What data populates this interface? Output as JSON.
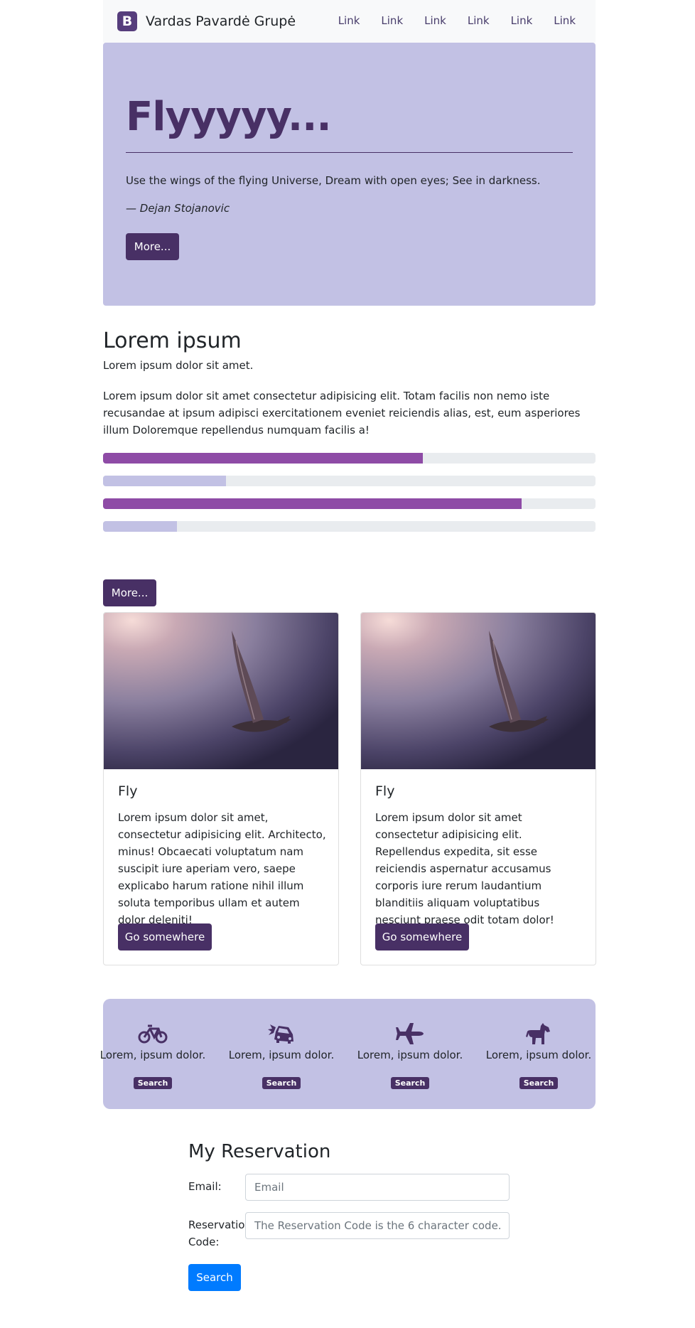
{
  "navbar": {
    "brand_logo": "B",
    "brand_name": "Vardas Pavardė Grupė",
    "links": [
      "Link",
      "Link",
      "Link",
      "Link",
      "Link",
      "Link"
    ]
  },
  "jumbotron": {
    "title": "Flyyyyy...",
    "quote": "Use the wings of the flying Universe, Dream with open eyes; See in darkness.",
    "author": "— Dejan Stojanovic",
    "button": "More..."
  },
  "lorem": {
    "heading": "Lorem ipsum",
    "short": "Lorem ipsum dolor sit amet.",
    "long": "Lorem ipsum dolor sit amet consectetur adipisicing elit. Totam facilis non nemo iste recusandae at ipsum adipisci exercitationem eveniet reiciendis alias, est, eum asperiores illum Doloremque repellendus numquam facilis a!",
    "progress": [
      {
        "value": 65,
        "color": "#8e4ba6"
      },
      {
        "value": 25,
        "color": "#c2c1e4"
      },
      {
        "value": 85,
        "color": "#8e4ba6"
      },
      {
        "value": 15,
        "color": "#c2c1e4"
      }
    ],
    "more_button": "More..."
  },
  "cards": [
    {
      "title": "Fly",
      "text": "Lorem ipsum dolor sit amet, consectetur adipisicing elit. Architecto, minus! Obcaecati voluptatum nam suscipit iure aperiam vero, saepe explicabo harum ratione nihil illum soluta temporibus ullam et autem dolor deleniti!",
      "button": "Go somewhere"
    },
    {
      "title": "Fly",
      "text": "Lorem ipsum dolor sit amet consectetur adipisicing elit. Repellendus expedita, sit esse reiciendis aspernatur accusamus corporis iure rerum laudantium blanditiis aliquam voluptatibus nesciunt praese odit totam dolor!",
      "button": "Go somewhere"
    }
  ],
  "strip": {
    "items": [
      {
        "icon": "bicycle-icon",
        "text": "Lorem, ipsum dolor.",
        "badge": "Search"
      },
      {
        "icon": "car-crash-icon",
        "text": "Lorem, ipsum dolor.",
        "badge": "Search"
      },
      {
        "icon": "plane-icon",
        "text": "Lorem, ipsum dolor.",
        "badge": "Search"
      },
      {
        "icon": "horse-icon",
        "text": "Lorem, ipsum dolor.",
        "badge": "Search"
      }
    ]
  },
  "reservation": {
    "heading": "My Reservation",
    "email_label": "Email:",
    "email_placeholder": "Email",
    "code_label": "Reservation Code:",
    "code_placeholder": "The Reservation Code is the 6 character code.",
    "button": "Search"
  },
  "colors": {
    "brand_purple": "#563d7c",
    "dark_purple": "#483065",
    "lavender": "#c2c1e4",
    "progress_purple": "#8e4ba6",
    "primary_blue": "#007bff"
  }
}
